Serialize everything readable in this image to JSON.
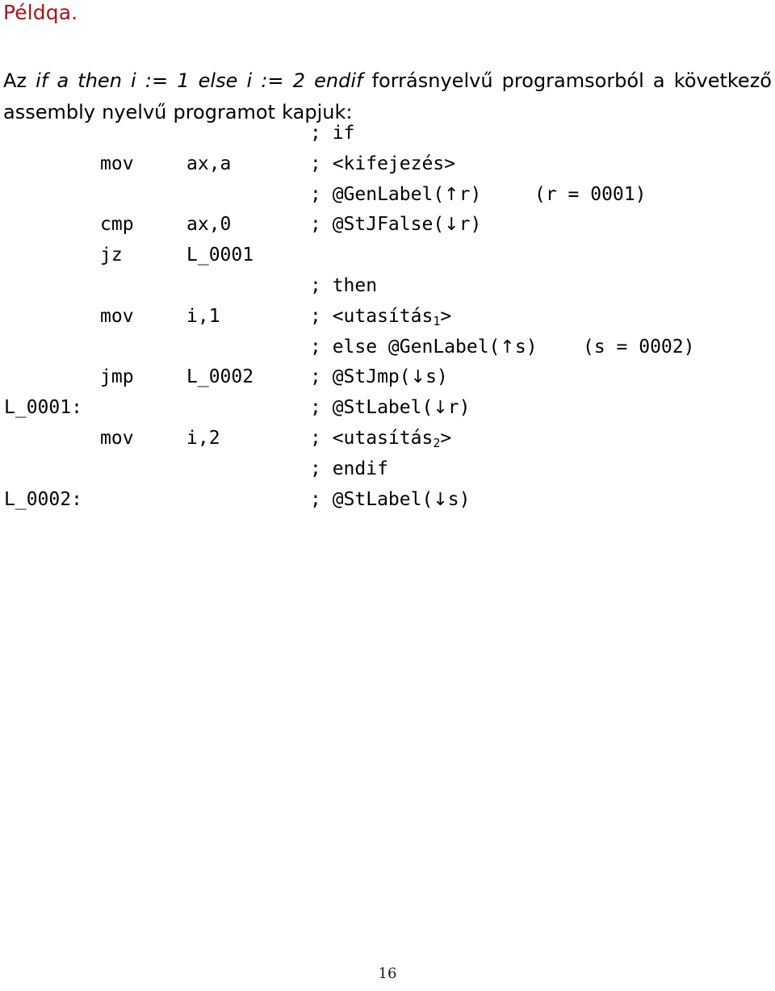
{
  "slide": {
    "title": "Példqa.",
    "title_color": "#A81419"
  },
  "intro": {
    "prefix": "Az ",
    "source_code": "if a then i := 1 else i := 2 endif",
    "suffix": " forrásnyelvű programsorból a következő assembly nyelvű programot kapjuk:"
  },
  "code": {
    "lines": [
      {
        "label": "",
        "mnemonic": "",
        "operand": "",
        "comment": "; if",
        "note": ""
      },
      {
        "label": "",
        "mnemonic": "mov",
        "operand": "ax,a",
        "comment": "; <kifejezés>",
        "note": ""
      },
      {
        "label": "",
        "mnemonic": "",
        "operand": "",
        "comment": "; @GenLabel(↑r)",
        "note": "(r = 0001)",
        "note_class": "note-r"
      },
      {
        "label": "",
        "mnemonic": "cmp",
        "operand": "ax,0",
        "comment": "; @StJFalse(↓r)",
        "note": ""
      },
      {
        "label": "",
        "mnemonic": "jz",
        "operand": "L_0001",
        "comment": "",
        "note": ""
      },
      {
        "label": "",
        "mnemonic": "",
        "operand": "",
        "comment": "; then",
        "note": ""
      },
      {
        "label": "",
        "mnemonic": "mov",
        "operand": "i,1",
        "comment": "; <utasítás₁>",
        "note": ""
      },
      {
        "label": "",
        "mnemonic": "",
        "operand": "",
        "comment": "; else @GenLabel(↑s)",
        "note": "(s = 0002)",
        "note_class": "note-s"
      },
      {
        "label": "",
        "mnemonic": "jmp",
        "operand": "L_0002",
        "comment": "; @StJmp(↓s)",
        "note": ""
      },
      {
        "label": "L_0001:",
        "mnemonic": "",
        "operand": "",
        "comment": "; @StLabel(↓r)",
        "note": ""
      },
      {
        "label": "",
        "mnemonic": "mov",
        "operand": "i,2",
        "comment": "; <utasítás₂>",
        "note": ""
      },
      {
        "label": "",
        "mnemonic": "",
        "operand": "",
        "comment": "; endif",
        "note": ""
      },
      {
        "label": "L_0002:",
        "mnemonic": "",
        "operand": "",
        "comment": "; @StLabel(↓s)",
        "note": ""
      }
    ]
  },
  "footer": {
    "page_number": "16"
  }
}
